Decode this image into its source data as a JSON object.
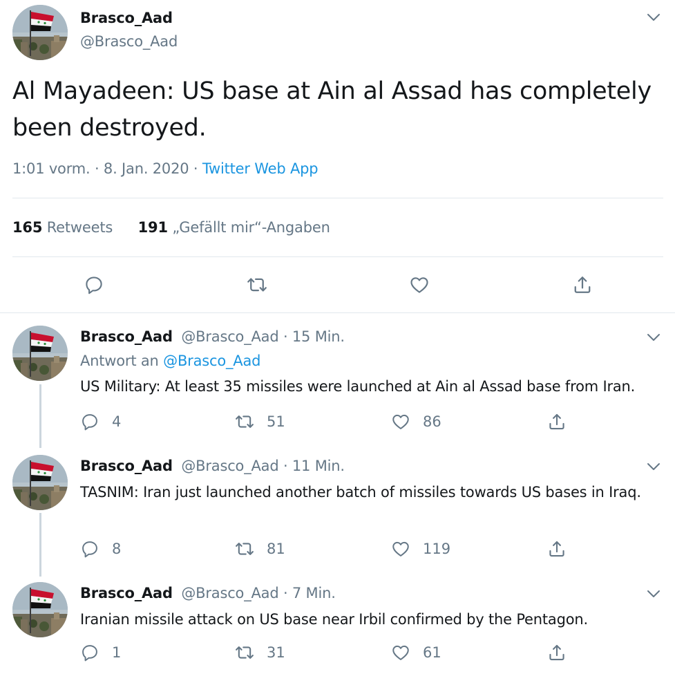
{
  "main_tweet": {
    "display_name": "Brasco_Aad",
    "handle": "@Brasco_Aad",
    "text": "Al Mayadeen: US base at Ain al Assad has completely been destroyed.",
    "time": "1:01 vorm. · 8. Jan. 2020 · ",
    "source": "Twitter Web App",
    "retweets_count": "165",
    "retweets_label": "Retweets",
    "likes_count": "191",
    "likes_label": "„Gefällt mir“-Angaben"
  },
  "replies": [
    {
      "display_name": "Brasco_Aad",
      "handle": "@Brasco_Aad",
      "time": " · 15 Min.",
      "reply_to_label": "Antwort an ",
      "reply_to_handle": "@Brasco_Aad",
      "text": "US Military: At least 35 missiles were launched at Ain al Assad base from Iran.",
      "replies": "4",
      "retweets": "51",
      "likes": "86"
    },
    {
      "display_name": "Brasco_Aad",
      "handle": "@Brasco_Aad",
      "time": " · 11 Min.",
      "text": "TASNIM: Iran just launched another batch of missiles towards US bases in Iraq.",
      "replies": "8",
      "retweets": "81",
      "likes": "119"
    },
    {
      "display_name": "Brasco_Aad",
      "handle": "@Brasco_Aad",
      "time": " · 7 Min.",
      "text": "Iranian missile attack on US base near Irbil confirmed by the Pentagon.",
      "replies": "1",
      "retweets": "31",
      "likes": "61"
    }
  ],
  "icons": {
    "reply": "reply-icon",
    "retweet": "retweet-icon",
    "like": "heart-icon",
    "share": "share-icon",
    "menu": "chevron-down-icon"
  },
  "colors": {
    "text": "#14171a",
    "muted": "#657786",
    "link": "#1b95e0",
    "divider": "#e1e8ed",
    "thread_line": "#ccd6dd"
  }
}
